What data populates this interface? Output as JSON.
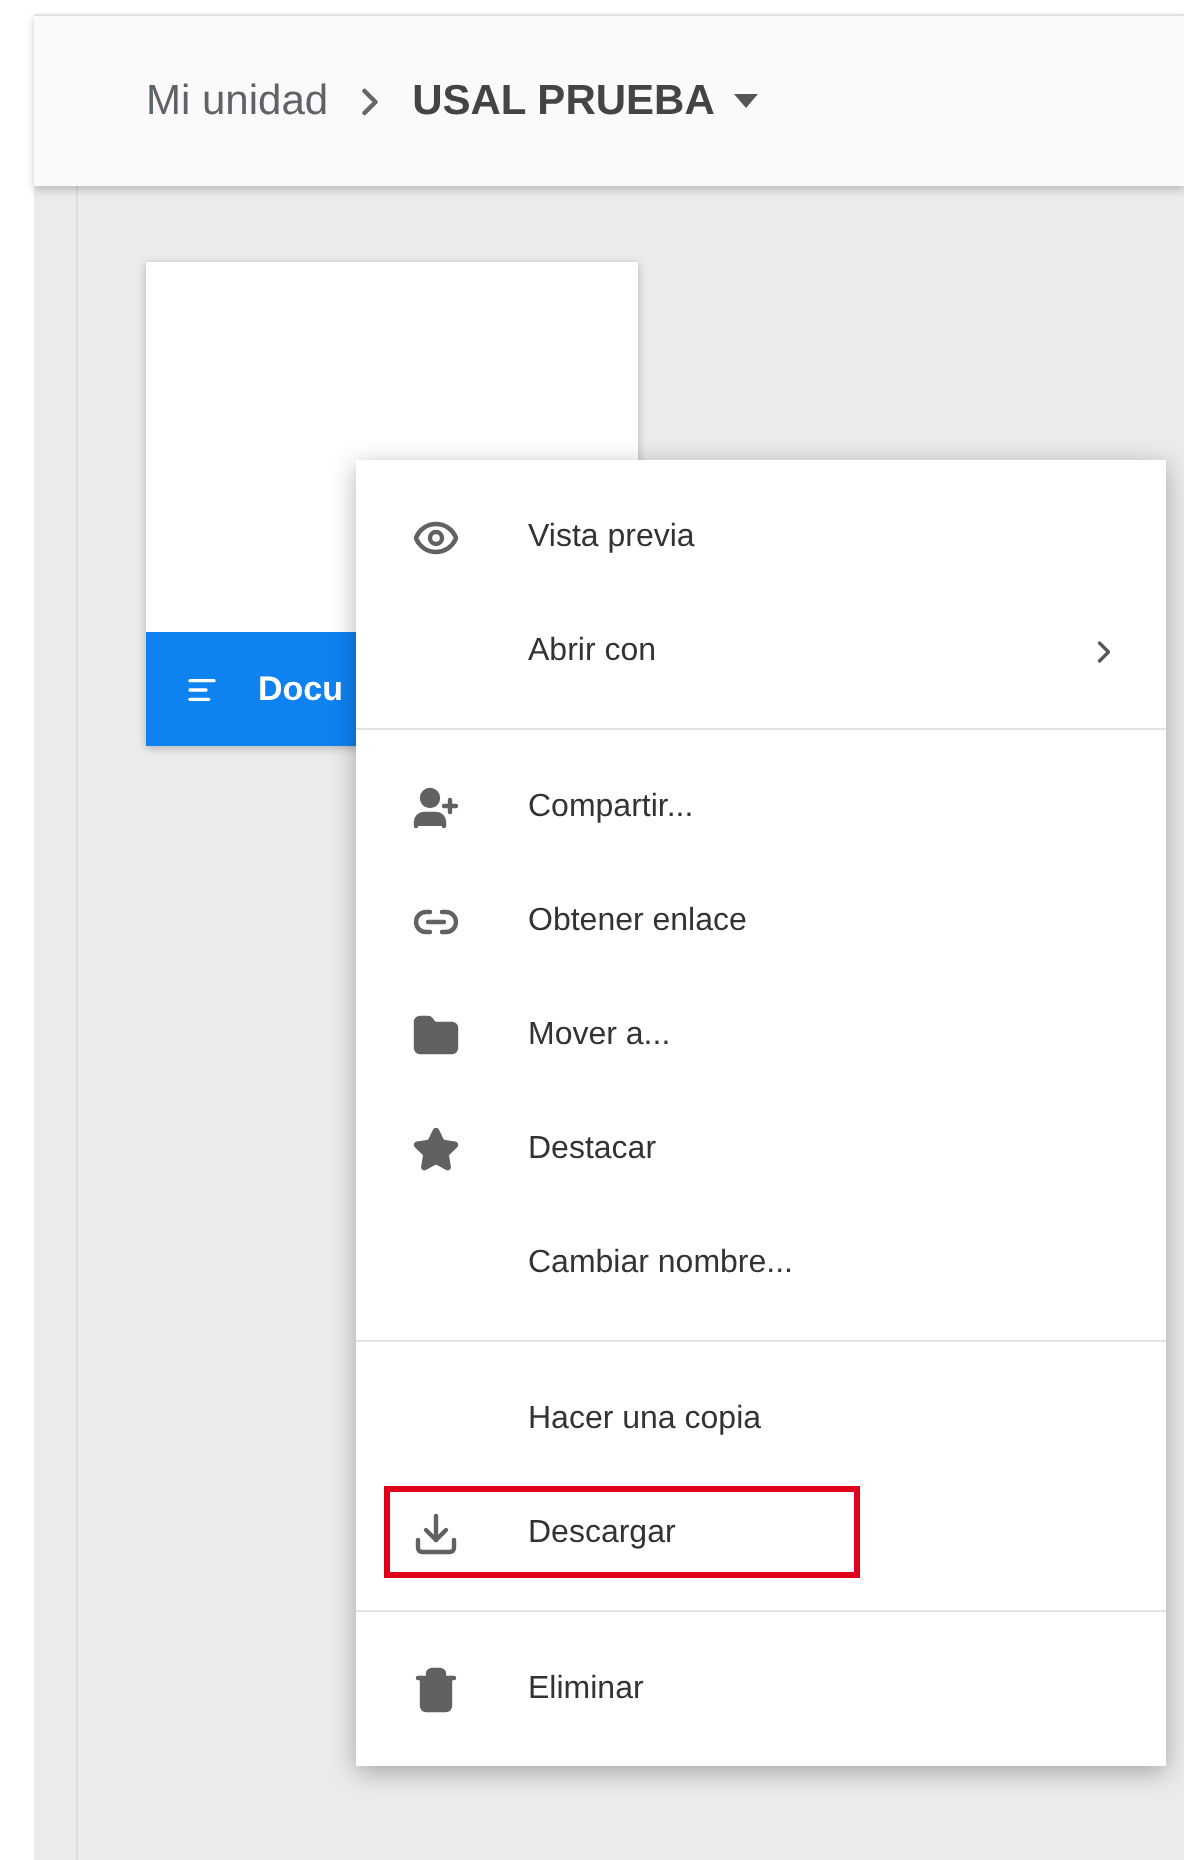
{
  "breadcrumb": {
    "parent": "Mi unidad",
    "current": "USAL PRUEBA"
  },
  "file_card": {
    "name": "Docu"
  },
  "context_menu": {
    "groups": [
      {
        "items": [
          {
            "label": "Vista previa",
            "submenu": false,
            "highlighted": false
          },
          {
            "label": "Abrir con",
            "submenu": true,
            "highlighted": false
          }
        ]
      },
      {
        "items": [
          {
            "label": "Compartir...",
            "submenu": false,
            "highlighted": false
          },
          {
            "label": "Obtener enlace",
            "submenu": false,
            "highlighted": false
          },
          {
            "label": "Mover a...",
            "submenu": false,
            "highlighted": false
          },
          {
            "label": "Destacar",
            "submenu": false,
            "highlighted": false
          },
          {
            "label": "Cambiar nombre...",
            "submenu": false,
            "highlighted": false
          }
        ]
      },
      {
        "items": [
          {
            "label": "Hacer una copia",
            "submenu": false,
            "highlighted": false
          },
          {
            "label": "Descargar",
            "submenu": false,
            "highlighted": true
          }
        ]
      },
      {
        "items": [
          {
            "label": "Eliminar",
            "submenu": false,
            "highlighted": false
          }
        ]
      }
    ]
  }
}
